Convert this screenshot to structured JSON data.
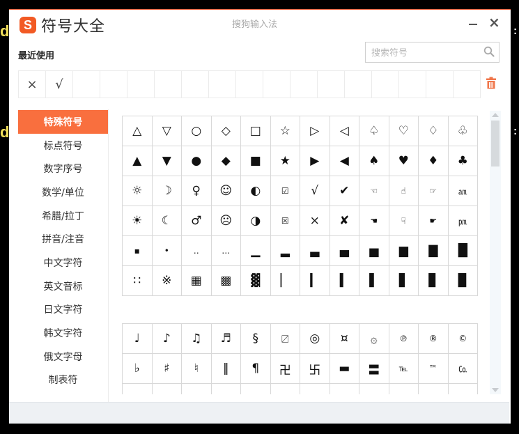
{
  "background": {
    "edge_letters": [
      "d",
      "d"
    ],
    "edge_colons": [
      ":",
      ":"
    ]
  },
  "window": {
    "logo_letter": "S",
    "title": "符号大全",
    "center_title": "搜狗输入法",
    "minimize_label": "minimize",
    "close_label": "×"
  },
  "recent": {
    "label": "最近使用",
    "cells": [
      "×",
      "√",
      "",
      "",
      "",
      "",
      "",
      "",
      "",
      "",
      "",
      "",
      "",
      "",
      "",
      "",
      ""
    ]
  },
  "search": {
    "placeholder": "搜索符号",
    "value": ""
  },
  "sidebar": {
    "items": [
      {
        "label": "特殊符号",
        "active": true
      },
      {
        "label": "标点符号",
        "active": false
      },
      {
        "label": "数字序号",
        "active": false
      },
      {
        "label": "数学/单位",
        "active": false
      },
      {
        "label": "希腊/拉丁",
        "active": false
      },
      {
        "label": "拼音/注音",
        "active": false
      },
      {
        "label": "中文字符",
        "active": false
      },
      {
        "label": "英文音标",
        "active": false
      },
      {
        "label": "日文字符",
        "active": false
      },
      {
        "label": "韩文字符",
        "active": false
      },
      {
        "label": "俄文字母",
        "active": false
      },
      {
        "label": "制表符",
        "active": false
      }
    ]
  },
  "symbols": {
    "table1": [
      [
        "△",
        "▽",
        "○",
        "◇",
        "□",
        "☆",
        "▷",
        "◁",
        "♤",
        "♡",
        "♢",
        "♧"
      ],
      [
        "▲",
        "▼",
        "●",
        "◆",
        "■",
        "★",
        "▶",
        "◀",
        "♠",
        "♥",
        "♦",
        "♣"
      ],
      [
        "☼",
        "☽",
        "♀",
        "☺",
        "◐",
        "☑",
        "√",
        "✔",
        "☜",
        "☝",
        "☞",
        "㏂"
      ],
      [
        "☀",
        "☾",
        "♂",
        "☹",
        "◑",
        "☒",
        "×",
        "✘",
        "☚",
        "☟",
        "☛",
        "㏘"
      ],
      [
        "▪",
        "•",
        "‥",
        "…",
        "▁",
        "▂",
        "▃",
        "▄",
        "▅",
        "▆",
        "▇",
        "█"
      ],
      [
        "∷",
        "※",
        "▦",
        "▩",
        "▓",
        "▏",
        "▎",
        "▍",
        "▌",
        "▋",
        "▊",
        "▉"
      ]
    ],
    "table2": [
      [
        "♩",
        "♪",
        "♫",
        "♬",
        "§",
        "〼",
        "◎",
        "¤",
        "۞",
        "℗",
        "®",
        "©"
      ],
      [
        "♭",
        "♯",
        "♮",
        "‖",
        "¶",
        "卍",
        "卐",
        "▬",
        "〓",
        "℡",
        "™",
        "㏇"
      ],
      [
        "",
        "",
        "",
        "",
        "",
        "",
        "",
        "",
        "",
        "",
        "",
        ""
      ]
    ]
  },
  "colors": {
    "accent": "#f96f3e",
    "logo": "#f25a24",
    "grid_border": "#d8d8d8"
  }
}
